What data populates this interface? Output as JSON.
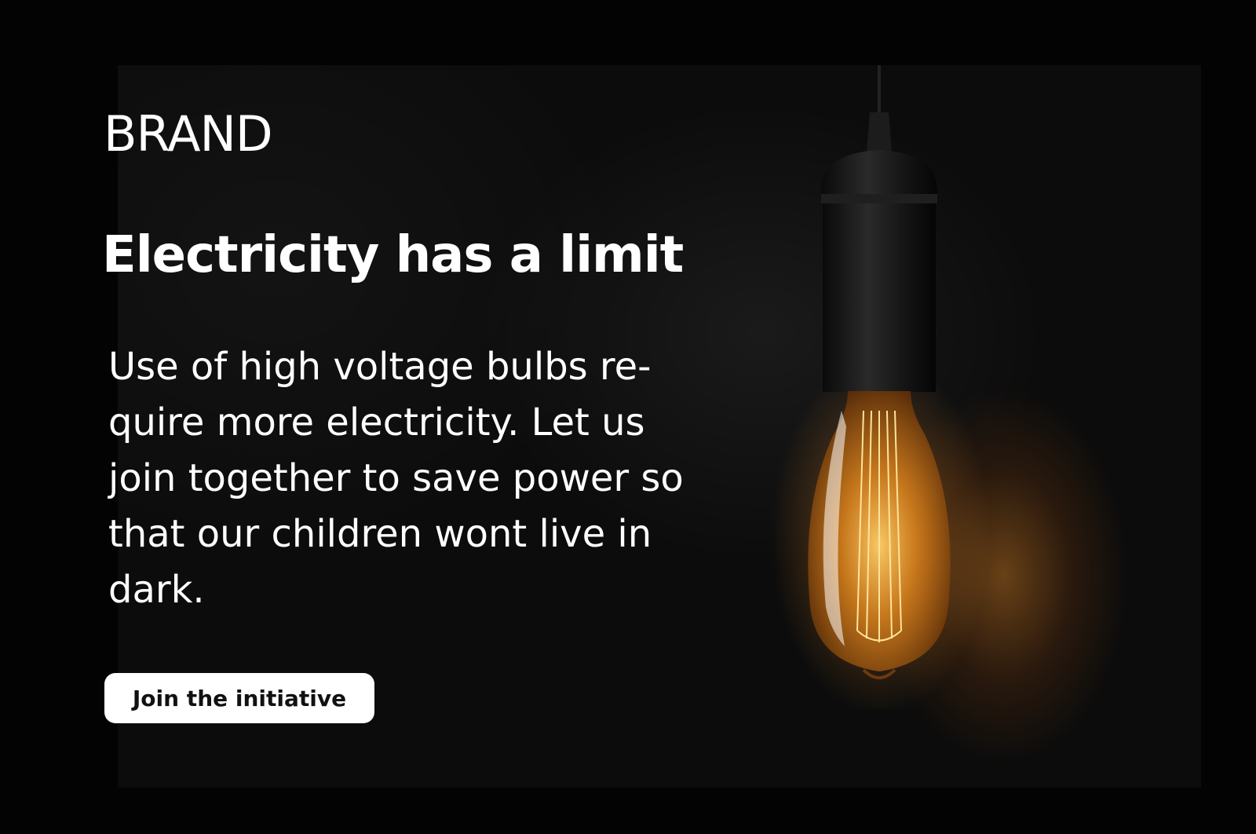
{
  "brand": {
    "name": "BRAND"
  },
  "hero": {
    "headline": "Electricity has a limit",
    "body": "Use of high voltage bulbs re- quire more electricity. Let us join together to save power so that our children wont live in dark."
  },
  "cta": {
    "label": "Join the initiative"
  },
  "image": {
    "subject": "lightbulb-icon"
  },
  "colors": {
    "background": "#030303",
    "text": "#ffffff",
    "button_bg": "#ffffff",
    "button_text": "#111111",
    "glow": "#ff9a2e"
  }
}
